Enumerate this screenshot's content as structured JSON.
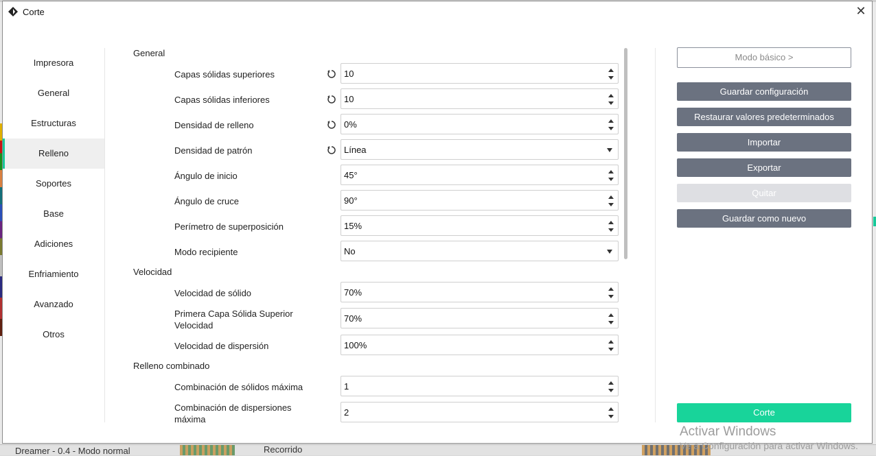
{
  "background": {
    "status_left": "Dreamer - 0.4 - Modo normal",
    "status_mid": "Recorrido"
  },
  "dialog": {
    "title": "Corte"
  },
  "sidebar": {
    "items": [
      {
        "label": "Impresora"
      },
      {
        "label": "General"
      },
      {
        "label": "Estructuras"
      },
      {
        "label": "Relleno"
      },
      {
        "label": "Soportes"
      },
      {
        "label": "Base"
      },
      {
        "label": "Adiciones"
      },
      {
        "label": "Enfriamiento"
      },
      {
        "label": "Avanzado"
      },
      {
        "label": "Otros"
      }
    ],
    "active": "Relleno"
  },
  "settings": {
    "section_general": "General",
    "section_velocidad": "Velocidad",
    "section_combinado": "Relleno combinado",
    "rows": [
      {
        "label": "Capas sólidas superiores",
        "value": "10"
      },
      {
        "label": "Capas sólidas inferiores",
        "value": "10"
      },
      {
        "label": "Densidad de relleno",
        "value": "0%"
      },
      {
        "label": "Densidad de patrón",
        "value": "Línea"
      },
      {
        "label": "Ángulo de inicio",
        "value": "45°"
      },
      {
        "label": "Ángulo de cruce",
        "value": "90°"
      },
      {
        "label": "Perímetro de superposición",
        "value": "15%"
      },
      {
        "label": "Modo recipiente",
        "value": "No"
      },
      {
        "label": "Velocidad de sólido",
        "value": "70%"
      },
      {
        "label": "Primera Capa Sólida Superior Velocidad",
        "value": "70%"
      },
      {
        "label": "Velocidad de dispersión",
        "value": "100%"
      },
      {
        "label": "Combinación de sólidos máxima",
        "value": "1"
      },
      {
        "label": "Combinación de dispersiones máxima",
        "value": "2"
      }
    ]
  },
  "actions": {
    "basic_mode": "Modo básico >",
    "save_config": "Guardar configuración",
    "restore_defaults": "Restaurar valores predeterminados",
    "import": "Importar",
    "export": "Exportar",
    "remove": "Quitar",
    "save_new": "Guardar como nuevo",
    "slice": "Corte"
  },
  "watermark": {
    "line1": "Activar Windows",
    "line2": "Ve a Configuración para activar Windows."
  },
  "colors": {
    "accent": "#18d49a",
    "button_dark": "#6b7280",
    "button_disabled": "#dedfe3"
  }
}
